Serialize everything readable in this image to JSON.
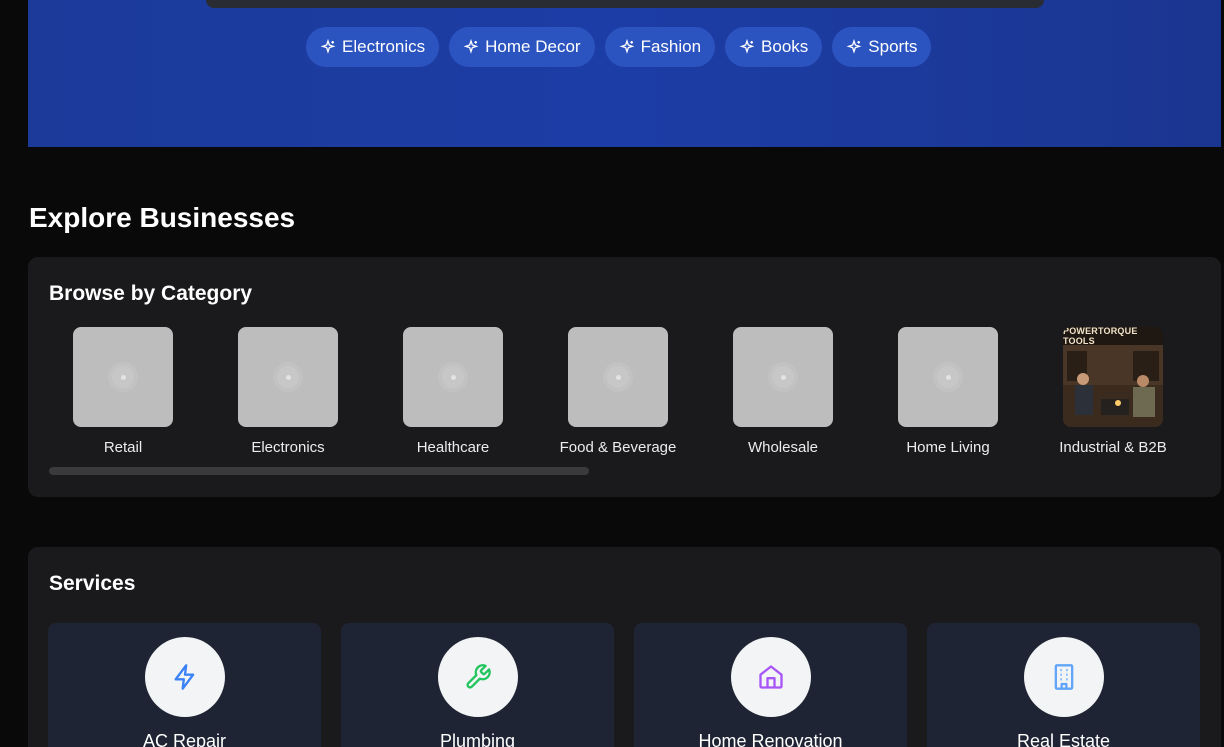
{
  "hero": {
    "chips": [
      {
        "label": "Electronics",
        "icon": "sparkle-icon"
      },
      {
        "label": "Home Decor",
        "icon": "sparkle-icon"
      },
      {
        "label": "Fashion",
        "icon": "sparkle-icon"
      },
      {
        "label": "Books",
        "icon": "sparkle-icon"
      },
      {
        "label": "Sports",
        "icon": "sparkle-icon"
      }
    ],
    "colors": {
      "background": "#1c3da6",
      "chip": "#2c54c0"
    }
  },
  "explore": {
    "title": "Explore Businesses"
  },
  "categories": {
    "title": "Browse by Category",
    "items": [
      {
        "label": "Retail"
      },
      {
        "label": "Electronics"
      },
      {
        "label": "Healthcare"
      },
      {
        "label": "Food & Beverage"
      },
      {
        "label": "Wholesale"
      },
      {
        "label": "Home Living"
      },
      {
        "label": "Industrial & B2B",
        "image_sign": "POWERTORQUE TOOLS"
      }
    ]
  },
  "services": {
    "title": "Services",
    "items": [
      {
        "label": "AC Repair",
        "icon": "lightning-icon",
        "color": "#3b82f6"
      },
      {
        "label": "Plumbing",
        "icon": "wrench-icon",
        "color": "#22c55e"
      },
      {
        "label": "Home Renovation",
        "icon": "house-icon",
        "color": "#a855f7"
      },
      {
        "label": "Real Estate",
        "icon": "building-icon",
        "color": "#60a5fa"
      }
    ]
  }
}
